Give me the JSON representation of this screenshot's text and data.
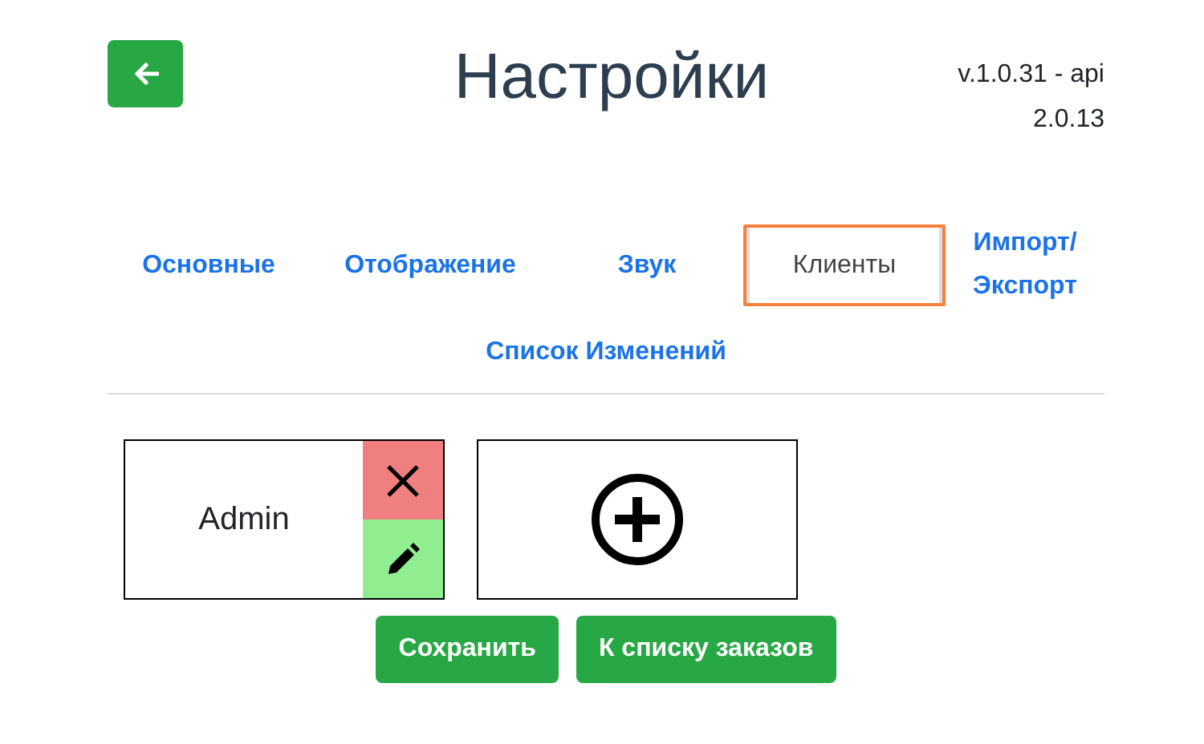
{
  "header": {
    "title": "Настройки",
    "version": "v.1.0.31 - api 2.0.13"
  },
  "tabs": [
    {
      "label": "Основные",
      "selected": false
    },
    {
      "label": "Отображение",
      "selected": false
    },
    {
      "label": "Звук",
      "selected": false
    },
    {
      "label": "Клиенты",
      "selected": true
    },
    {
      "label": "Импорт/ Экспорт",
      "selected": false
    },
    {
      "label": "Список Изменений",
      "selected": false
    }
  ],
  "clients": [
    {
      "name": "Admin"
    }
  ],
  "buttons": [
    "Сохранить",
    "К списку заказов"
  ]
}
